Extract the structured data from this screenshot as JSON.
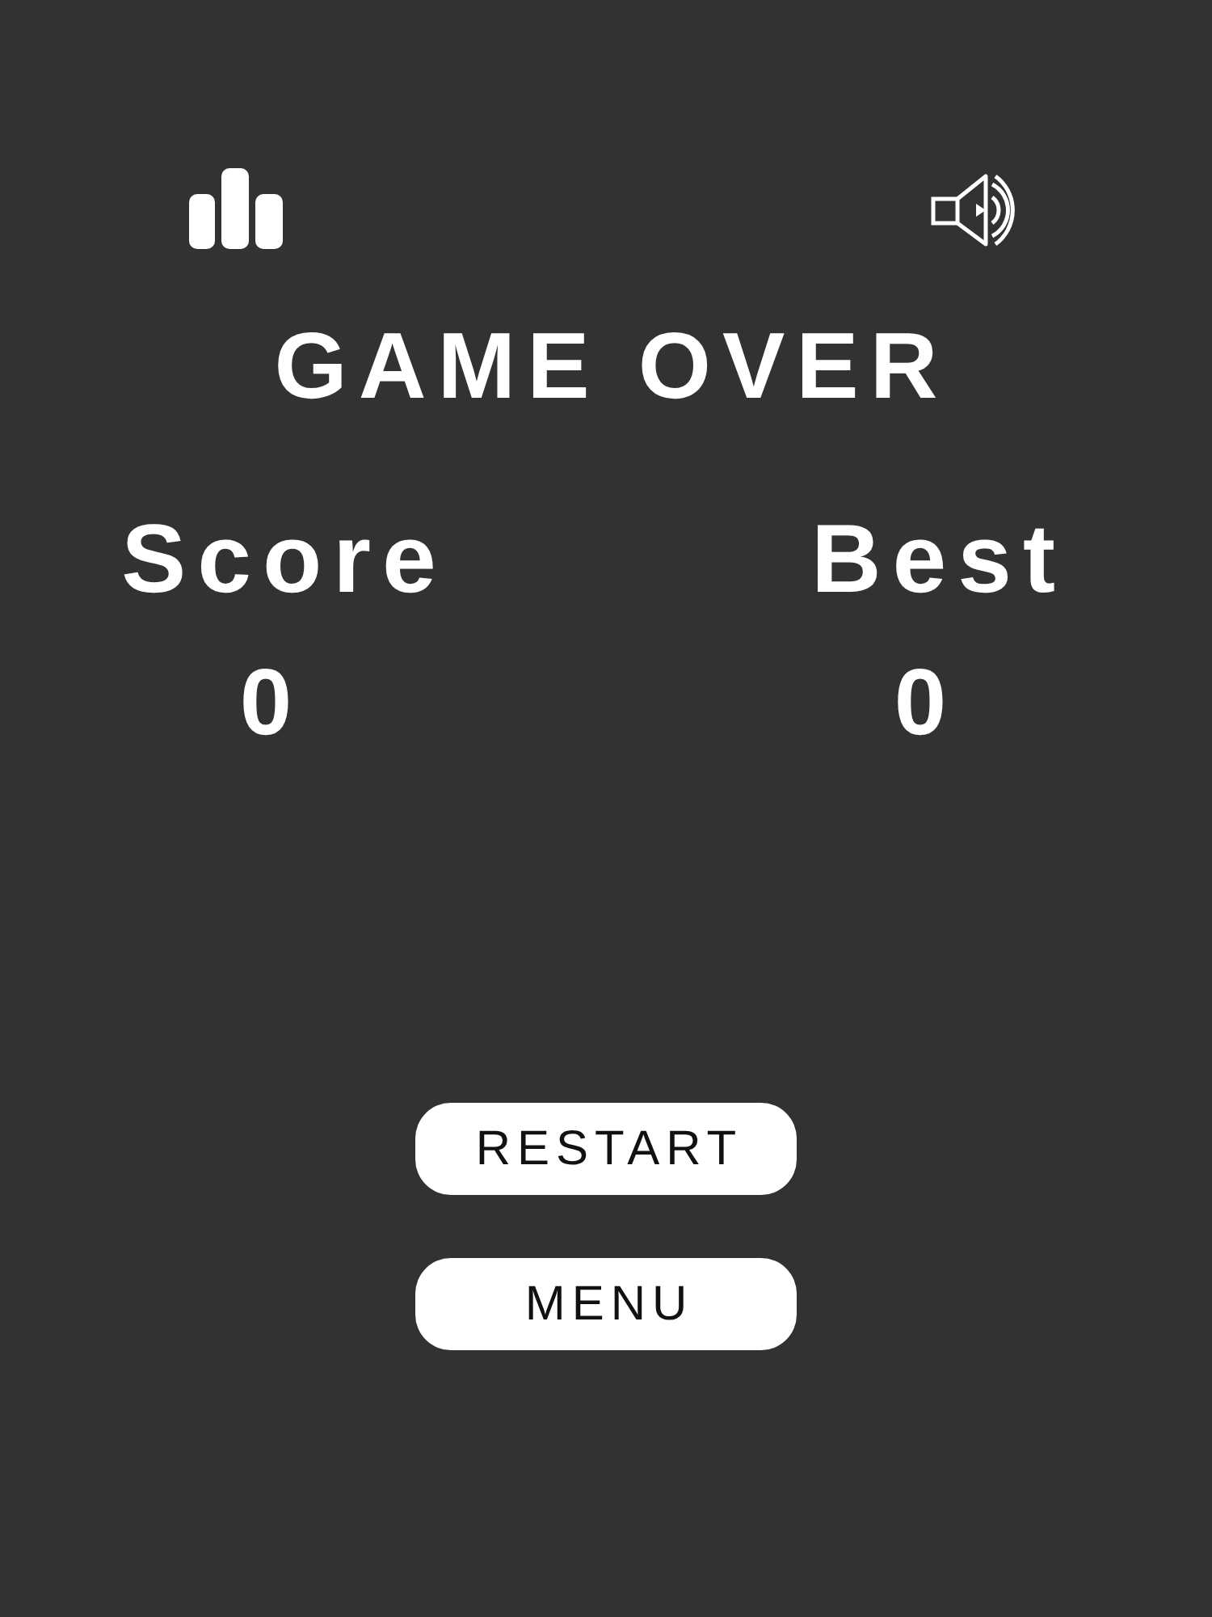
{
  "title": "GAME OVER",
  "stats": [
    {
      "label": "Score",
      "value": "0"
    },
    {
      "label": "Best",
      "value": "0"
    }
  ],
  "sound": {
    "on": true
  },
  "buttons": [
    {
      "label": "RESTART"
    },
    {
      "label": "MENU"
    }
  ]
}
